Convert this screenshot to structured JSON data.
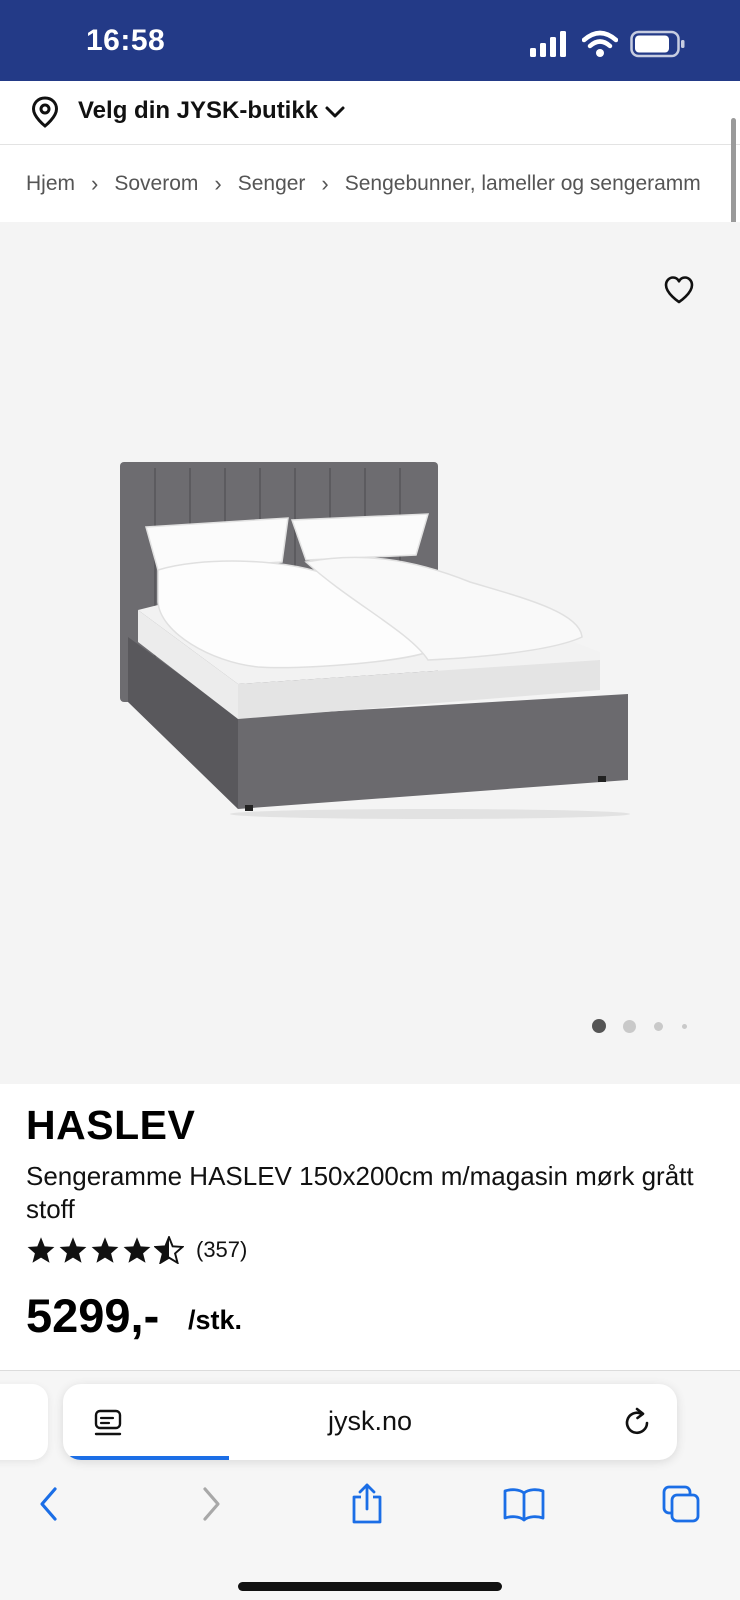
{
  "status_bar": {
    "time": "16:58",
    "icons": [
      "signal-icon",
      "wifi-icon",
      "battery-icon"
    ],
    "color": "#233a87"
  },
  "store_selector": {
    "label": "Velg din JYSK-butikk",
    "icon": "location-pin-icon"
  },
  "breadcrumb": {
    "items": [
      "Hjem",
      "Soverom",
      "Senger",
      "Sengebunner, lameller og sengeramm"
    ]
  },
  "gallery": {
    "image_alt": "bed-photo",
    "favorite_icon": "heart-icon",
    "image_count": 4,
    "active_index": 0
  },
  "product": {
    "brand": "HASLEV",
    "description": "Sengeramme HASLEV 150x200cm m/magasin mørk grått stoff",
    "rating": 4.5,
    "rating_max": 5,
    "review_count": "(357)",
    "price": "5299,-",
    "unit": "/stk."
  },
  "browser": {
    "url": "jysk.no",
    "load_progress": 0.27,
    "accent": "#1b6ee6",
    "toolbar": [
      "back-icon",
      "forward-icon",
      "share-icon",
      "bookmarks-icon",
      "tabs-icon"
    ]
  }
}
